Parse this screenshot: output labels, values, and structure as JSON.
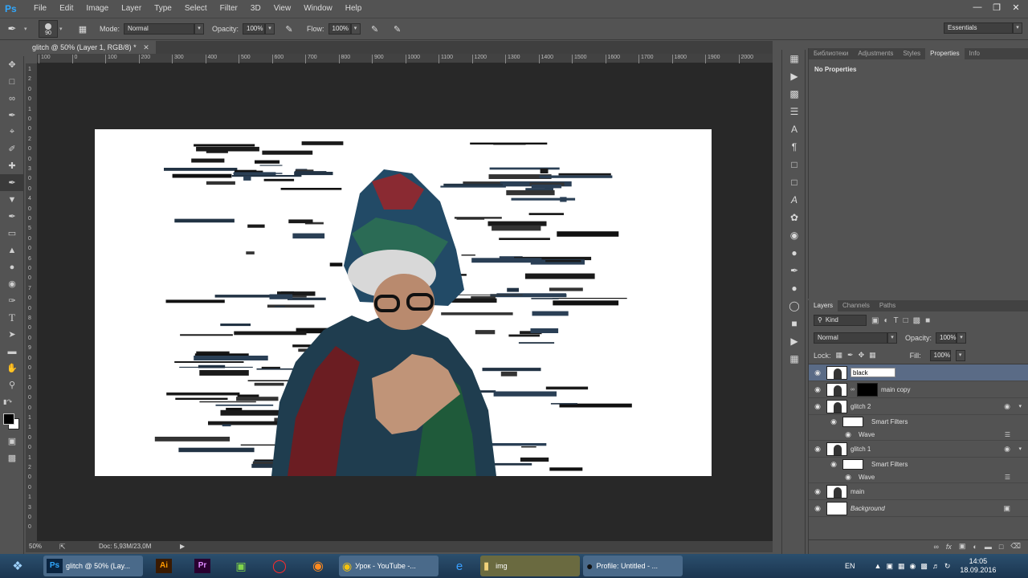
{
  "menubar": {
    "logo": "Ps",
    "items": [
      "File",
      "Edit",
      "Image",
      "Layer",
      "Type",
      "Select",
      "Filter",
      "3D",
      "View",
      "Window",
      "Help"
    ]
  },
  "options": {
    "brush_size": "90",
    "mode_label": "Mode:",
    "mode_value": "Normal",
    "opacity_label": "Opacity:",
    "opacity_value": "100%",
    "flow_label": "Flow:",
    "flow_value": "100%",
    "workspace": "Essentials"
  },
  "document": {
    "tab_title": "glitch @ 50% (Layer 1, RGB/8) *",
    "zoom": "50%",
    "doc_size": "Doc: 5,93M/23,0M",
    "ruler_h": [
      "100",
      "0",
      "100",
      "200",
      "300",
      "400",
      "500",
      "600",
      "700",
      "800",
      "900",
      "1000",
      "1100",
      "1200",
      "1300",
      "1400",
      "1500",
      "1600",
      "1700",
      "1800",
      "1900",
      "2000"
    ],
    "ruler_v": [
      "1",
      "2",
      "0",
      "0",
      "1",
      "0",
      "0",
      "2",
      "0",
      "0",
      "3",
      "0",
      "0",
      "4",
      "0",
      "0",
      "5",
      "0",
      "0",
      "6",
      "0",
      "0",
      "7",
      "0",
      "0",
      "8",
      "0",
      "0",
      "9",
      "0",
      "0",
      "1",
      "0",
      "0",
      "0",
      "1",
      "1",
      "0",
      "0",
      "1",
      "2",
      "0",
      "0",
      "1",
      "3",
      "0",
      "0"
    ]
  },
  "properties": {
    "tabs": [
      "Библиотеки",
      "Adjustments",
      "Styles",
      "Properties",
      "Info"
    ],
    "active_tab": "Properties",
    "content": "No Properties"
  },
  "layers": {
    "tabs": [
      "Layers",
      "Channels",
      "Paths"
    ],
    "kind_value": "Kind",
    "blend_value": "Normal",
    "opacity_label": "Opacity:",
    "opacity_value": "100%",
    "lock_label": "Lock:",
    "fill_label": "Fill:",
    "fill_value": "100%",
    "rows": [
      {
        "name": "black",
        "editing": true
      },
      {
        "name": "main copy"
      },
      {
        "name": "glitch 2"
      },
      {
        "name": "Smart Filters",
        "sub": true
      },
      {
        "name": "Wave",
        "sub2": true
      },
      {
        "name": "glitch 1"
      },
      {
        "name": "Smart Filters",
        "sub": true
      },
      {
        "name": "Wave",
        "sub2": true
      },
      {
        "name": "main"
      },
      {
        "name": "Background",
        "italic": true
      }
    ]
  },
  "taskbar": {
    "items": [
      {
        "label": "glitch @ 50% (Lay..."
      },
      {
        "label": ""
      },
      {
        "label": ""
      },
      {
        "label": ""
      },
      {
        "label": ""
      },
      {
        "label": ""
      },
      {
        "label": "Урок - YouTube -..."
      },
      {
        "label": ""
      },
      {
        "label": "img"
      },
      {
        "label": "Profile: Untitled - ..."
      }
    ],
    "lang": "EN",
    "time": "14:05",
    "date": "18.09.2016"
  }
}
